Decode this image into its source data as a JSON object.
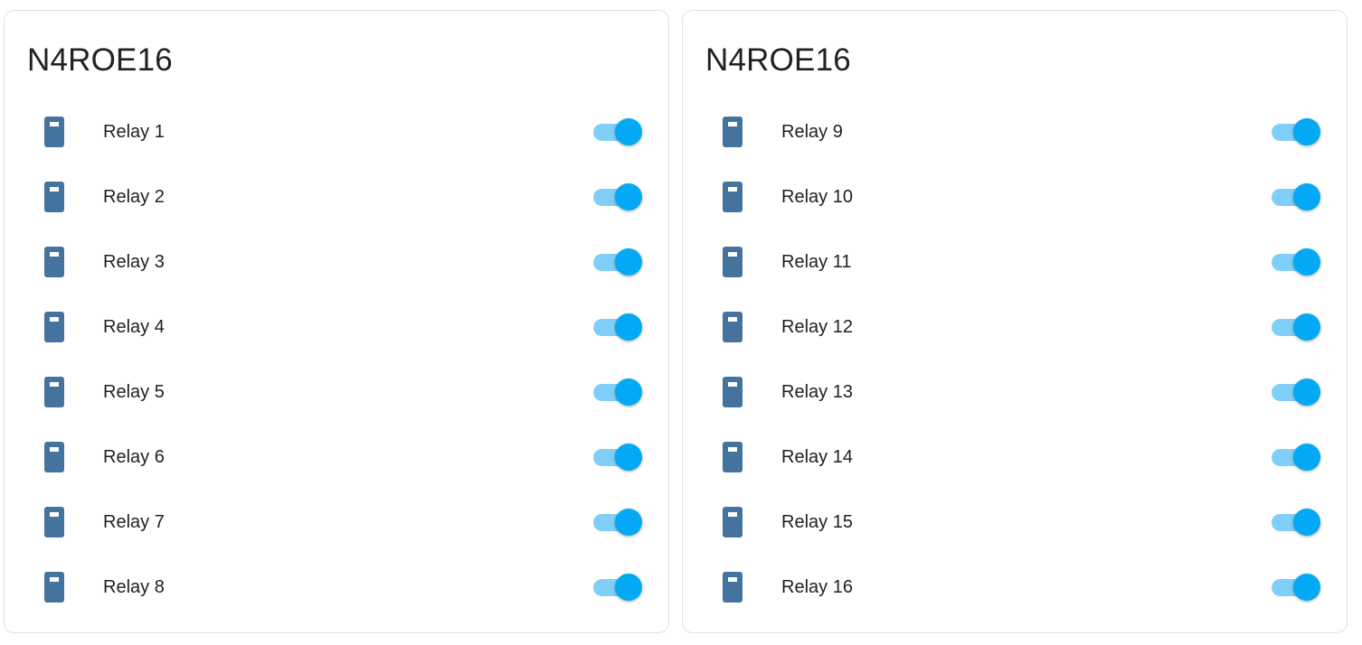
{
  "colors": {
    "icon": "#44739e",
    "toggle_on_thumb": "#03a9f4",
    "toggle_on_track": "#7fcff8",
    "text": "#212121",
    "card_border": "#e0e0e0"
  },
  "cards": [
    {
      "title": "N4ROE16",
      "entities": [
        {
          "icon": "relay-icon",
          "label": "Relay 1",
          "state": "on"
        },
        {
          "icon": "relay-icon",
          "label": "Relay 2",
          "state": "on"
        },
        {
          "icon": "relay-icon",
          "label": "Relay 3",
          "state": "on"
        },
        {
          "icon": "relay-icon",
          "label": "Relay 4",
          "state": "on"
        },
        {
          "icon": "relay-icon",
          "label": "Relay 5",
          "state": "on"
        },
        {
          "icon": "relay-icon",
          "label": "Relay 6",
          "state": "on"
        },
        {
          "icon": "relay-icon",
          "label": "Relay 7",
          "state": "on"
        },
        {
          "icon": "relay-icon",
          "label": "Relay 8",
          "state": "on"
        }
      ]
    },
    {
      "title": "N4ROE16",
      "entities": [
        {
          "icon": "relay-icon",
          "label": "Relay 9",
          "state": "on"
        },
        {
          "icon": "relay-icon",
          "label": "Relay 10",
          "state": "on"
        },
        {
          "icon": "relay-icon",
          "label": "Relay 11",
          "state": "on"
        },
        {
          "icon": "relay-icon",
          "label": "Relay 12",
          "state": "on"
        },
        {
          "icon": "relay-icon",
          "label": "Relay 13",
          "state": "on"
        },
        {
          "icon": "relay-icon",
          "label": "Relay 14",
          "state": "on"
        },
        {
          "icon": "relay-icon",
          "label": "Relay 15",
          "state": "on"
        },
        {
          "icon": "relay-icon",
          "label": "Relay 16",
          "state": "on"
        }
      ]
    }
  ]
}
